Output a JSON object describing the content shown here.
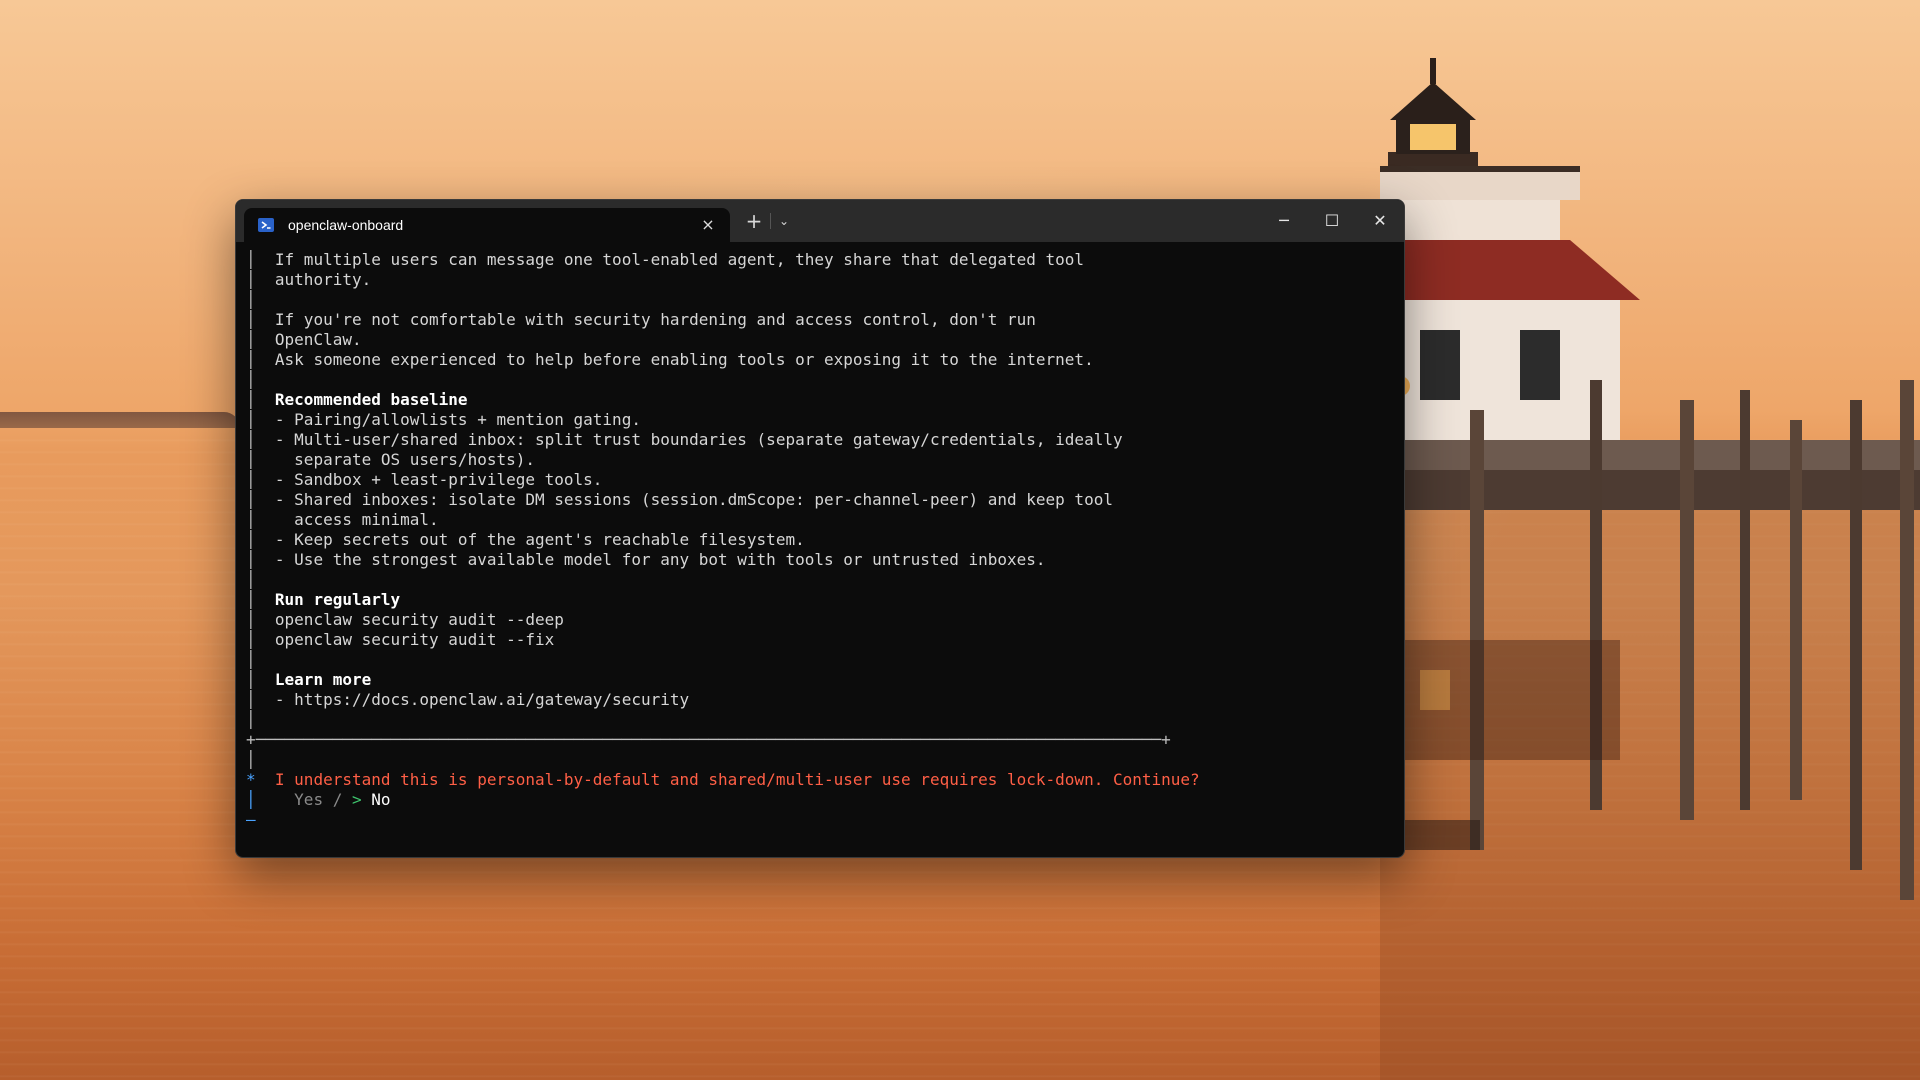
{
  "window": {
    "tab_title": "openclaw-onboard",
    "tab_close": "×",
    "new_tab": "+",
    "dropdown": "⌄",
    "minimize": "─",
    "maximize": "☐",
    "close": "✕"
  },
  "terminal": {
    "lines": [
      "If multiple users can message one tool-enabled agent, they share that delegated tool",
      "authority.",
      "",
      "If you're not comfortable with security hardening and access control, don't run",
      "OpenClaw.",
      "Ask someone experienced to help before enabling tools or exposing it to the internet.",
      "",
      "Recommended baseline",
      "- Pairing/allowlists + mention gating.",
      "- Multi-user/shared inbox: split trust boundaries (separate gateway/credentials, ideally",
      "  separate OS users/hosts).",
      "- Sandbox + least-privilege tools.",
      "- Shared inboxes: isolate DM sessions (session.dmScope: per-channel-peer) and keep tool",
      "  access minimal.",
      "- Keep secrets out of the agent's reachable filesystem.",
      "- Use the strongest available model for any bot with tools or untrusted inboxes.",
      "",
      "Run regularly",
      "openclaw security audit --deep",
      "openclaw security audit --fix",
      "",
      "Learn more",
      "- https://docs.openclaw.ai/gateway/security",
      ""
    ],
    "box_bottom": "+──────────────────────────────────────────────────────────────────────────────────────────────+",
    "prompt_marker": "*",
    "prompt_text": "I understand this is personal-by-default and shared/multi-user use requires lock-down. Continue?",
    "option_yes": "Yes",
    "option_sep": "/",
    "option_cursor": ">",
    "option_no": "No",
    "end_marker": "—"
  },
  "colors": {
    "terminal_bg": "#0c0c0c",
    "prompt_red": "#ff5f46",
    "marker_blue": "#4aa3ff",
    "cursor_green": "#3ec46d"
  }
}
